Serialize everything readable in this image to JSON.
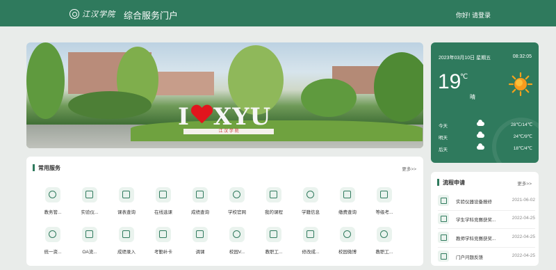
{
  "header": {
    "logo_text": "江汉学院",
    "portal_title": "综合服务门户",
    "login_prompt": "你好! 请登录",
    "bg_color": "#2f7a5d"
  },
  "banner": {
    "sign_left": "I",
    "sign_right": "XYU",
    "sign_base": "江 汉 学 院"
  },
  "weather": {
    "date": "2023年03月10日 星期五",
    "time": "08:32:05",
    "temperature": "19",
    "unit": "℃",
    "condition": "晴",
    "forecast": [
      {
        "day": "今天",
        "icon": "cloud-icon",
        "range": "28℃/14℃"
      },
      {
        "day": "明天",
        "icon": "cloud-icon",
        "range": "24℃/9℃"
      },
      {
        "day": "后天",
        "icon": "cloud-icon",
        "range": "18℃/4℃"
      }
    ]
  },
  "services": {
    "title": "常用服务",
    "more": "更多>>",
    "items": [
      {
        "label": "教务管...",
        "icon": "globe-icon"
      },
      {
        "label": "实验仪...",
        "icon": "flask-icon"
      },
      {
        "label": "课表查询",
        "icon": "calendar-icon"
      },
      {
        "label": "在线选课",
        "icon": "book-icon"
      },
      {
        "label": "成绩查询",
        "icon": "score-icon"
      },
      {
        "label": "学校官网",
        "icon": "school-seal-icon"
      },
      {
        "label": "我的课程",
        "icon": "calendar-icon"
      },
      {
        "label": "学籍信息",
        "icon": "certificate-icon"
      },
      {
        "label": "缴费查询",
        "icon": "payment-icon"
      },
      {
        "label": "等级考...",
        "icon": "exam-icon"
      },
      {
        "label": "统一资...",
        "icon": "resource-icon"
      },
      {
        "label": "OA流...",
        "icon": "workflow-icon"
      },
      {
        "label": "成绩录入",
        "icon": "edit-icon"
      },
      {
        "label": "考勤补卡",
        "icon": "attendance-icon"
      },
      {
        "label": "调课",
        "icon": "document-icon"
      },
      {
        "label": "校园V...",
        "icon": "location-icon"
      },
      {
        "label": "教职工...",
        "icon": "staff-icon"
      },
      {
        "label": "修改成...",
        "icon": "score-edit-icon"
      },
      {
        "label": "校园微博",
        "icon": "weibo-icon"
      },
      {
        "label": "教职工...",
        "icon": "search-person-icon"
      }
    ]
  },
  "flow": {
    "title": "流程申请",
    "more": "更多>>",
    "items": [
      {
        "title": "实验仪器设备报修",
        "date": "2021-06-02",
        "icon": "flask-icon"
      },
      {
        "title": "学生学科竞赛获奖...",
        "date": "2022-04-25",
        "icon": "award-icon"
      },
      {
        "title": "教师学科竞赛获奖...",
        "date": "2022-04-25",
        "icon": "teacher-icon"
      },
      {
        "title": "门户问题反馈",
        "date": "2022-04-25",
        "icon": "feedback-icon"
      }
    ]
  }
}
